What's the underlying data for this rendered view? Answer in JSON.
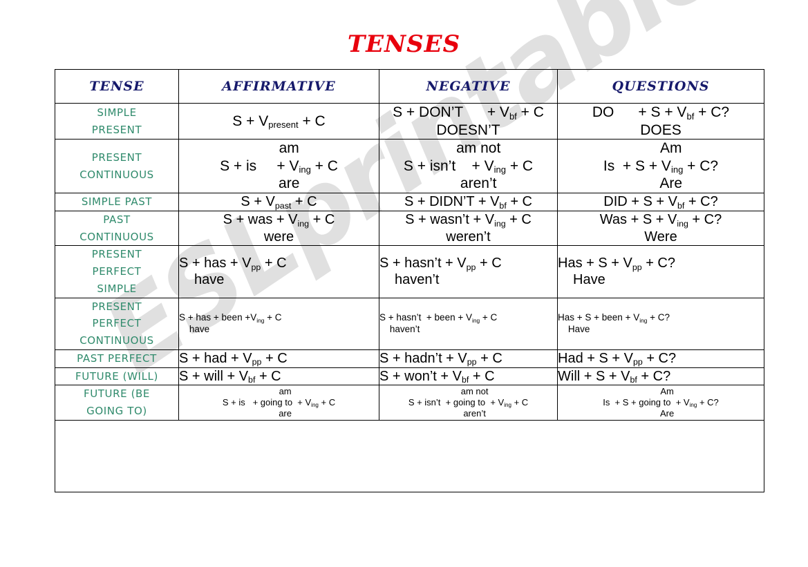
{
  "document": {
    "title": "TENSES",
    "watermark": "ESLprintables.com",
    "colors": {
      "title_red": "#e8000d",
      "header_navy": "#16196b",
      "tense_green": "#2f8a6b",
      "border_black": "#000000",
      "watermark_gray": "#c8c8c8"
    }
  },
  "table": {
    "headers": [
      "TENSE",
      "AFFIRMATIVE",
      "NEGATIVE",
      "QUESTIONS"
    ],
    "rows": [
      {
        "tense": [
          "SIMPLE",
          "PRESENT"
        ],
        "size": "lg",
        "affirmative": {
          "align": "center",
          "lines": [
            "S + V|present| + C"
          ]
        },
        "negative": {
          "align": "center",
          "lines": [
            "S + DON’T      + V|bf| + C",
            "DOESN’T"
          ]
        },
        "questions": {
          "align": "center",
          "lines": [
            "DO      + S + V|bf| + C?",
            "DOES"
          ]
        }
      },
      {
        "tense": [
          "PRESENT",
          "CONTINUOUS"
        ],
        "size": "lg",
        "affirmative": {
          "align": "center",
          "lines": [
            "am",
            "S + is     + V|ing| + C",
            "are"
          ]
        },
        "negative": {
          "align": "center",
          "lines": [
            "am not",
            "S + isn’t    + V|ing| + C",
            "aren’t"
          ]
        },
        "questions": {
          "align": "center",
          "lines": [
            "Am",
            "Is  + S + V|ing| + C?",
            "Are"
          ]
        }
      },
      {
        "tense": [
          "SIMPLE PAST"
        ],
        "size": "md",
        "affirmative": {
          "align": "center",
          "lines": [
            "S + V|past| + C"
          ]
        },
        "negative": {
          "align": "center",
          "lines": [
            "S + DIDN’T + V|bf| + C"
          ]
        },
        "questions": {
          "align": "center",
          "lines": [
            "DID + S + V|bf| + C?"
          ]
        }
      },
      {
        "tense": [
          "PAST",
          "CONTINUOUS"
        ],
        "size": "md",
        "affirmative": {
          "align": "center",
          "lines": [
            "S + was + V|ing| + C",
            "were"
          ]
        },
        "negative": {
          "align": "center",
          "lines": [
            "S + wasn’t + V|ing| + C",
            "weren’t"
          ]
        },
        "questions": {
          "align": "center",
          "lines": [
            "Was + S + V|ing| + C?",
            "Were"
          ]
        }
      },
      {
        "tense": [
          "PRESENT",
          "PERFECT",
          "SIMPLE"
        ],
        "size": "md",
        "affirmative": {
          "align": "left",
          "lines": [
            "S + has + V|pp| + C",
            "have"
          ]
        },
        "negative": {
          "align": "left",
          "lines": [
            "S + hasn’t + V|pp| + C",
            "haven’t"
          ]
        },
        "questions": {
          "align": "left",
          "lines": [
            "Has + S + V|pp| + C?",
            "Have"
          ]
        }
      },
      {
        "tense": [
          "PRESENT",
          "PERFECT",
          "CONTINUOUS"
        ],
        "size": "sm",
        "affirmative": {
          "align": "left",
          "lines": [
            "S + has + been +V|ing| + C",
            "have"
          ]
        },
        "negative": {
          "align": "left",
          "lines": [
            "S + hasn’t  + been + V|ing| + C",
            "haven’t"
          ]
        },
        "questions": {
          "align": "left",
          "lines": [
            "Has + S + been + V|ing| + C?",
            "Have"
          ]
        }
      },
      {
        "tense": [
          "PAST PERFECT"
        ],
        "size": "md",
        "affirmative": {
          "align": "left",
          "lines": [
            "S + had + V|pp| + C"
          ]
        },
        "negative": {
          "align": "left",
          "lines": [
            "S + hadn’t + V|pp| + C"
          ]
        },
        "questions": {
          "align": "left",
          "lines": [
            "Had + S + V|pp| + C?"
          ]
        }
      },
      {
        "tense": [
          "FUTURE (WILL)"
        ],
        "size": "md",
        "affirmative": {
          "align": "left",
          "lines": [
            "S + will + V|bf| + C"
          ]
        },
        "negative": {
          "align": "left",
          "lines": [
            "S + won’t + V|bf| + C"
          ]
        },
        "questions": {
          "align": "left",
          "lines": [
            "Will + S + V|bf| + C?"
          ]
        }
      },
      {
        "tense": [
          "FUTURE (BE",
          "GOING TO)"
        ],
        "size": "xs",
        "affirmative": {
          "align": "center",
          "lines": [
            "am",
            "S + is   + going to  + V|ing| + C",
            "are"
          ]
        },
        "negative": {
          "align": "center",
          "lines": [
            "am not",
            "S + isn’t  + going to  + V|ing| + C",
            "aren’t"
          ]
        },
        "questions": {
          "align": "center",
          "lines": [
            "Am",
            "Is  + S + going to  + V|ing| + C?",
            "Are"
          ]
        }
      }
    ],
    "empty_row": {
      "content": ""
    }
  }
}
